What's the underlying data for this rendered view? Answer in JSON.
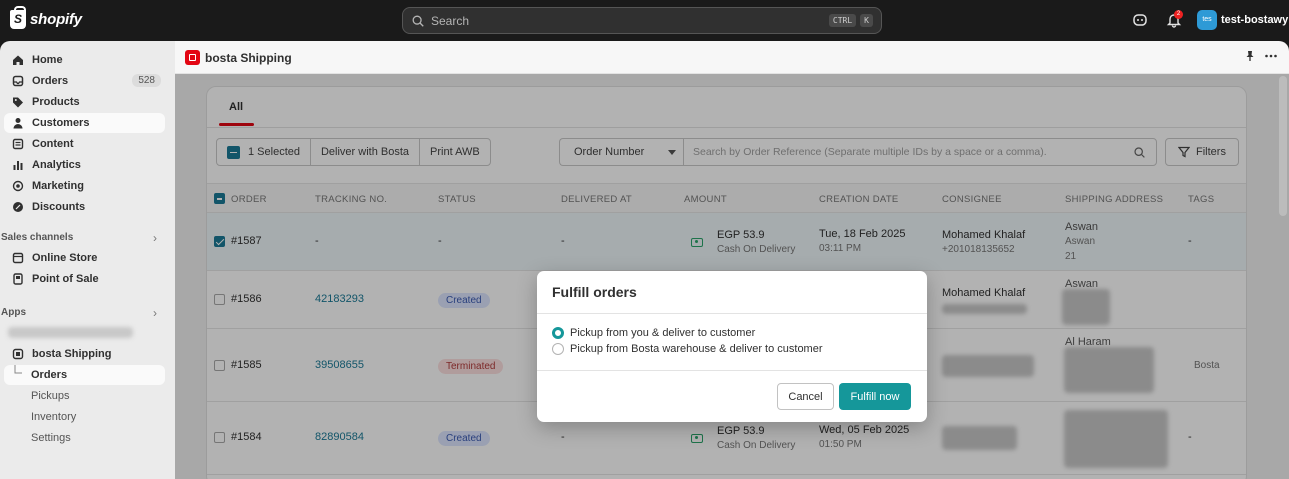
{
  "topbar": {
    "logo_text": "shopify",
    "search_placeholder": "Search",
    "shortcut_key1": "CTRL",
    "shortcut_key2": "K",
    "notification_count": "2",
    "avatar_initials": "tes",
    "store_name": "test-bostawy"
  },
  "sidebar": {
    "items": [
      {
        "label": "Home",
        "icon": "home-icon"
      },
      {
        "label": "Orders",
        "icon": "orders-icon",
        "count": "528"
      },
      {
        "label": "Products",
        "icon": "tag-icon"
      },
      {
        "label": "Customers",
        "icon": "person-icon"
      },
      {
        "label": "Content",
        "icon": "content-icon"
      },
      {
        "label": "Analytics",
        "icon": "bar-chart-icon"
      },
      {
        "label": "Marketing",
        "icon": "target-icon"
      },
      {
        "label": "Discounts",
        "icon": "discount-icon"
      }
    ],
    "sales_channels_heading": "Sales channels",
    "channels": [
      {
        "label": "Online Store",
        "icon": "store-icon"
      },
      {
        "label": "Point of Sale",
        "icon": "pos-icon"
      }
    ],
    "apps_heading": "Apps",
    "app_name": "bosta Shipping",
    "app_subitems": [
      "Orders",
      "Pickups",
      "Inventory",
      "Settings"
    ]
  },
  "app_header": {
    "title": "bosta Shipping"
  },
  "tabs": [
    "All"
  ],
  "toolbar": {
    "selected_label": "1 Selected",
    "deliver_label": "Deliver with Bosta",
    "print_label": "Print AWB",
    "filter_field": "Order Number",
    "search_placeholder": "Search by Order Reference (Separate multiple IDs by a space or a comma).",
    "filters_label": "Filters"
  },
  "table": {
    "columns": [
      "ORDER",
      "TRACKING NO.",
      "STATUS",
      "DELIVERED AT",
      "AMOUNT",
      "CREATION DATE",
      "CONSIGNEE",
      "SHIPPING ADDRESS",
      "TAGS"
    ],
    "rows": [
      {
        "order": "#1587",
        "tracking": "-",
        "status": "-",
        "delivered": "-",
        "amount": "EGP 53.9",
        "payment": "Cash On Delivery",
        "date": "Tue, 18 Feb 2025",
        "time": "03:11 PM",
        "consignee": "Mohamed Khalaf",
        "phone": "+201018135652",
        "address1": "Aswan",
        "address2": "Aswan",
        "address3": "21",
        "tags": "-"
      },
      {
        "order": "#1586",
        "tracking": "42183293",
        "status": "Created",
        "consignee": "Mohamed Khalaf",
        "address1": "Aswan"
      },
      {
        "order": "#1585",
        "tracking": "39508655",
        "status": "Terminated",
        "address1": "Al Haram",
        "tags": "Bosta"
      },
      {
        "order": "#1584",
        "tracking": "82890584",
        "status": "Created",
        "delivered": "-",
        "amount": "EGP 53.9",
        "payment": "Cash On Delivery",
        "date": "Wed, 05 Feb 2025",
        "time": "01:50 PM",
        "tags": "-"
      }
    ]
  },
  "modal": {
    "title": "Fulfill orders",
    "options": [
      "Pickup from you & deliver to customer",
      "Pickup from Bosta warehouse & deliver to customer"
    ],
    "selected_option": 0,
    "cancel_label": "Cancel",
    "confirm_label": "Fulfill now"
  },
  "colors": {
    "accent_teal": "#15979a",
    "link_blue": "#1b7a97",
    "bosta_red": "#e30613"
  }
}
